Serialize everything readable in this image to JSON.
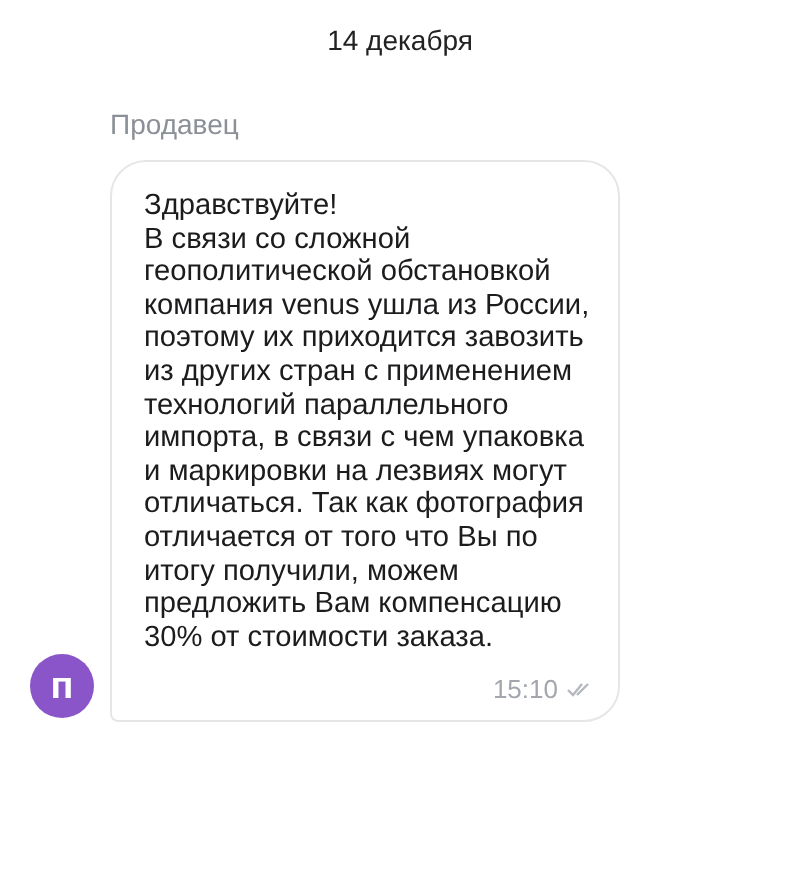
{
  "date_separator": "14 декабря",
  "message": {
    "sender": "Продавец",
    "avatar_letter": "п",
    "text": "Здравствуйте!\nВ связи со сложной геополитической обстановкой компания venus ушла из России, поэтому их приходится завозить из других стран с применением технологий параллельного импорта, в связи с чем упаковка и маркировки на лезвиях могут отличаться. Так как фотография отличается от того что Вы по итогу получили, можем предложить Вам компенсацию 30% от стоимости заказа.",
    "time": "15:10",
    "read": true
  }
}
